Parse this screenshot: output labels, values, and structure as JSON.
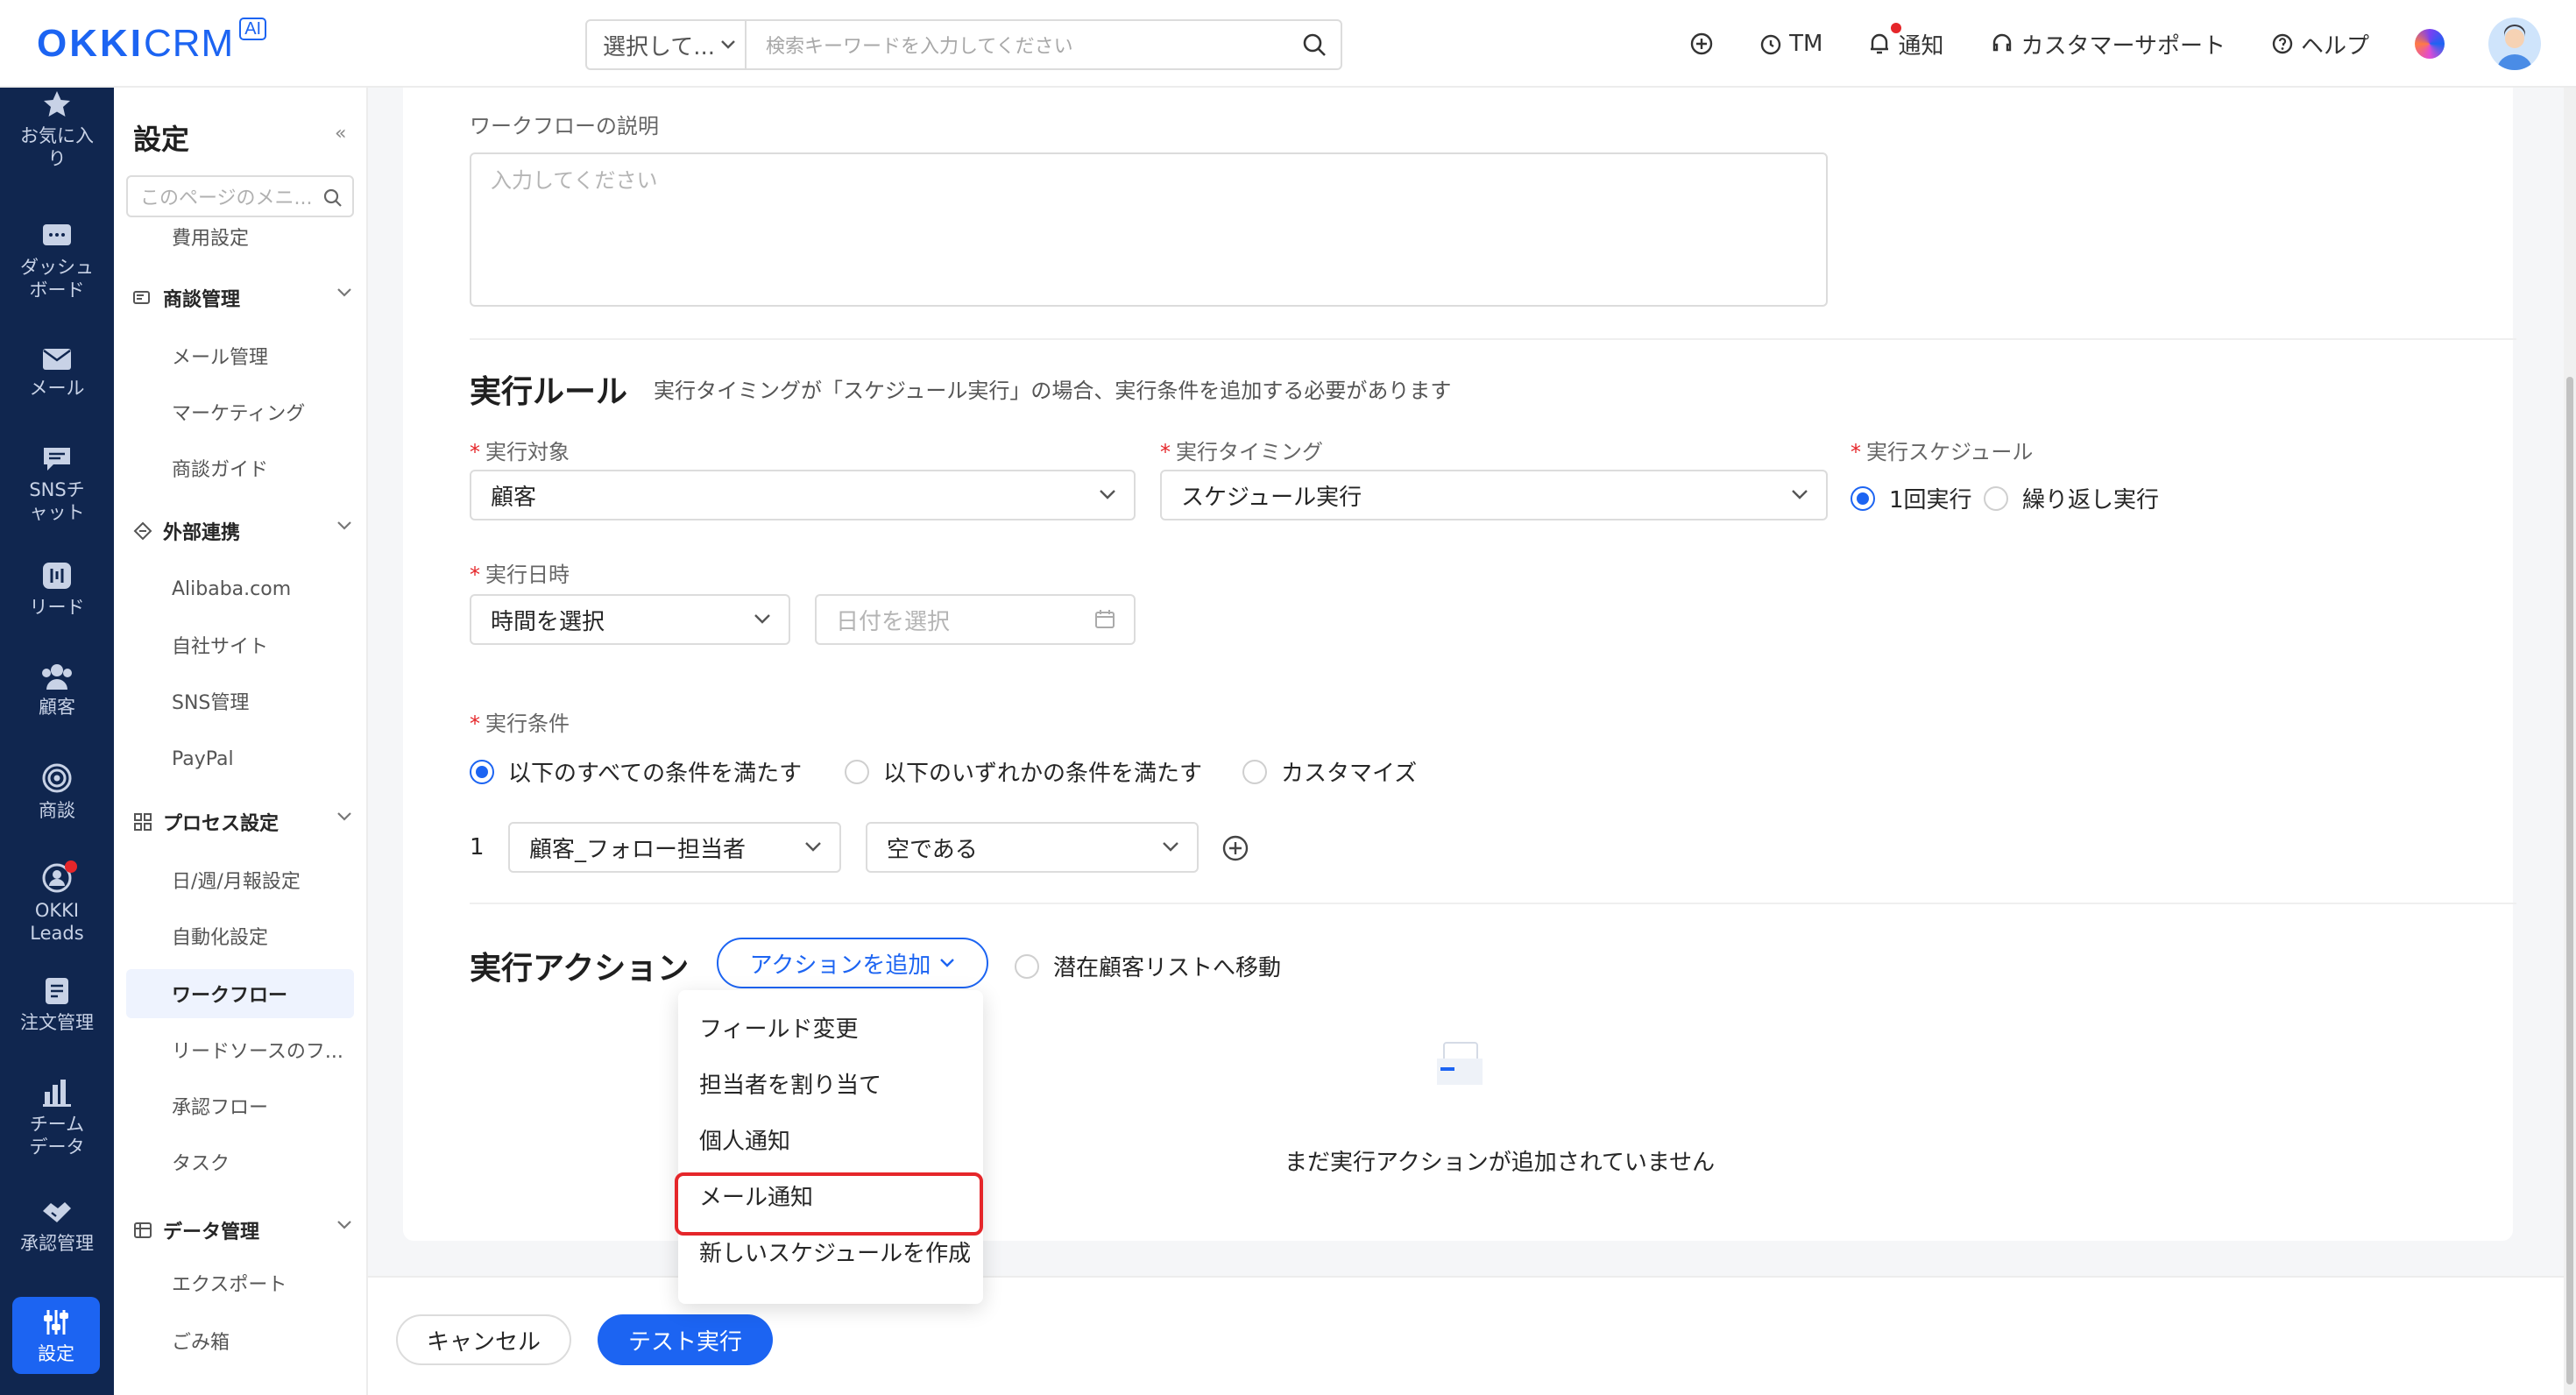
{
  "header": {
    "logo_main": "OKKI",
    "logo_sub": "CRM",
    "logo_badge": "AI",
    "search_select": "選択して...",
    "search_placeholder": "検索キーワードを入力してください",
    "actions": {
      "tm": "TM",
      "notify": "通知",
      "support": "カスタマーサポート",
      "help": "ヘルプ"
    }
  },
  "leftnav": {
    "items": [
      {
        "label": "お気に入り",
        "icon": "star-icon"
      },
      {
        "label": "ダッシュボード",
        "icon": "dashboard-icon"
      },
      {
        "label": "メール",
        "icon": "mail-icon"
      },
      {
        "label": "SNSチャット",
        "icon": "chat-icon"
      },
      {
        "label": "リード",
        "icon": "leads-icon"
      },
      {
        "label": "顧客",
        "icon": "customer-icon"
      },
      {
        "label": "商談",
        "icon": "target-icon"
      },
      {
        "label": "OKKI Leads",
        "icon": "okki-leads-icon"
      },
      {
        "label": "注文管理",
        "icon": "order-icon"
      },
      {
        "label": "チームデータ",
        "icon": "chart-icon"
      },
      {
        "label": "承認管理",
        "icon": "approval-icon"
      },
      {
        "label": "設定",
        "icon": "settings-icon"
      }
    ]
  },
  "sidebar": {
    "title": "設定",
    "collapse": "«",
    "search_placeholder": "このページのメニ...",
    "top_item": "費用設定",
    "groups": [
      {
        "title": "商談管理",
        "items": [
          "メール管理",
          "マーケティング",
          "商談ガイド"
        ]
      },
      {
        "title": "外部連携",
        "items": [
          "Alibaba.com",
          "自社サイト",
          "SNS管理",
          "PayPal"
        ]
      },
      {
        "title": "プロセス設定",
        "items": [
          "日/週/月報設定",
          "自動化設定",
          "ワークフロー",
          "リードソースのフ...",
          "承認フロー",
          "タスク"
        ]
      },
      {
        "title": "データ管理",
        "items": [
          "エクスポート",
          "ごみ箱"
        ]
      }
    ]
  },
  "form": {
    "description_label": "ワークフローの説明",
    "description_placeholder": "入力してください",
    "rules_title": "実行ルール",
    "rules_hint": "実行タイミングが「スケジュール実行」の場合、実行条件を追加する必要があります",
    "target_label": "実行対象",
    "target_value": "顧客",
    "timing_label": "実行タイミング",
    "timing_value": "スケジュール実行",
    "schedule_label": "実行スケジュール",
    "schedule_once": "1回実行",
    "schedule_repeat": "繰り返し実行",
    "datetime_label": "実行日時",
    "time_value": "時間を選択",
    "date_placeholder": "日付を選択",
    "condition_label": "実行条件",
    "cond_all": "以下のすべての条件を満たす",
    "cond_any": "以下のいずれかの条件を満たす",
    "cond_custom": "カスタマイズ",
    "cond_row_index": "1",
    "cond_field": "顧客_フォロー担当者",
    "cond_operator": "空である",
    "actions_title": "実行アクション",
    "add_action": "アクションを追加",
    "move_to_pool": "潜在顧客リストへ移動",
    "empty_text": "まだ実行アクションが追加されていません"
  },
  "dropdown": {
    "items": [
      "フィールド変更",
      "担当者を割り当て",
      "個人通知",
      "メール通知",
      "新しいスケジュールを作成"
    ]
  },
  "footer": {
    "cancel": "キャンセル",
    "test_run": "テスト実行"
  },
  "colors": {
    "brand": "#1c64f2",
    "nav_bg": "#10264f",
    "required": "#e5262a",
    "highlight": "#e5262a"
  }
}
